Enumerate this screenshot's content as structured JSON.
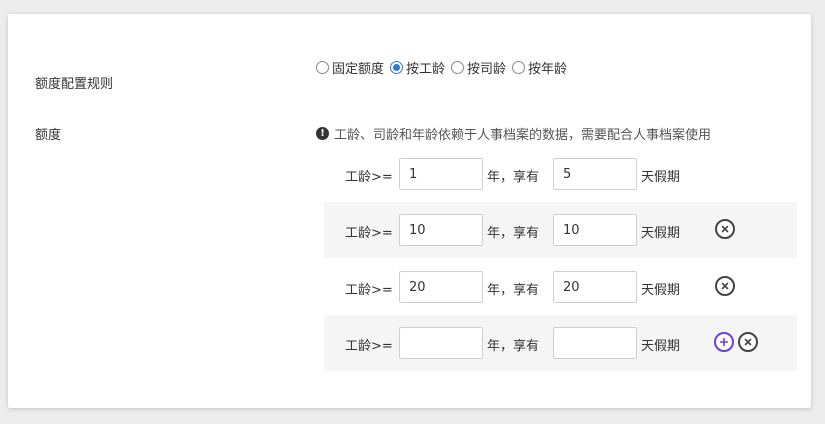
{
  "form": {
    "rule_label": "额度配置规则",
    "quota_label": "额度",
    "radio_options": [
      {
        "label": "固定额度",
        "checked": false
      },
      {
        "label": "按工龄",
        "checked": true
      },
      {
        "label": "按司龄",
        "checked": false
      },
      {
        "label": "按年龄",
        "checked": false
      }
    ],
    "notice": "工龄、司龄和年龄依赖于人事档案的数据，需要配合人事档案使用",
    "rows": [
      {
        "prefix": "工龄>=",
        "min": "1",
        "mid": "年，享有",
        "days": "5",
        "suffix": "天假期"
      },
      {
        "prefix": "工龄>=",
        "min": "10",
        "mid": "年，享有",
        "days": "10",
        "suffix": "天假期"
      },
      {
        "prefix": "工龄>=",
        "min": "20",
        "mid": "年，享有",
        "days": "20",
        "suffix": "天假期"
      },
      {
        "prefix": "工龄>=",
        "min": "",
        "mid": "年，享有",
        "days": "",
        "suffix": "天假期"
      }
    ]
  },
  "colors": {
    "accent": "#2d7bd8",
    "add_button": "#6a3ee0",
    "row_shade": "#f5f5f5"
  },
  "icons": {
    "notice": "info-icon",
    "add": "plus-circle-icon",
    "remove": "close-circle-icon"
  }
}
